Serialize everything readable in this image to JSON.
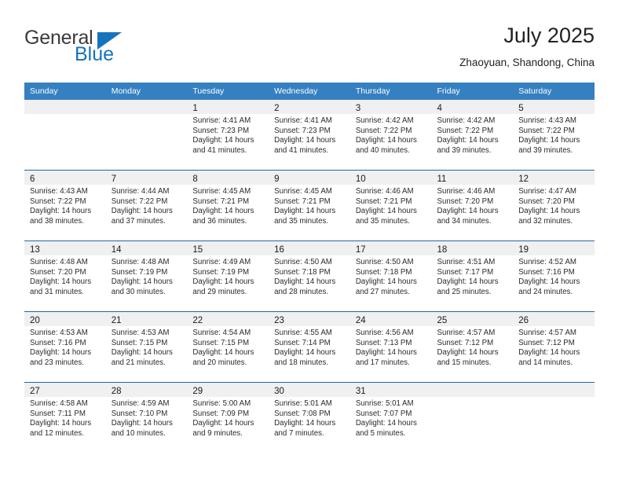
{
  "brand": {
    "name_top": "General",
    "name_bottom": "Blue",
    "triangle_color": "#1673bd"
  },
  "header": {
    "title": "July 2025",
    "location": "Zhaoyuan, Shandong, China"
  },
  "theme": {
    "header_blue": "#3580c0",
    "row_divider_blue": "#2266a8",
    "daynum_band": "#f0f0f0",
    "text": "#2b2b2b"
  },
  "calendar": {
    "weekday_headers": [
      "Sunday",
      "Monday",
      "Tuesday",
      "Wednesday",
      "Thursday",
      "Friday",
      "Saturday"
    ],
    "labels": {
      "sunrise": "Sunrise:",
      "sunset": "Sunset:",
      "daylight": "Daylight:"
    },
    "weeks": [
      [
        {
          "day": "",
          "lines": []
        },
        {
          "day": "",
          "lines": []
        },
        {
          "day": "1",
          "lines": [
            "Sunrise: 4:41 AM",
            "Sunset: 7:23 PM",
            "Daylight: 14 hours and 41 minutes."
          ]
        },
        {
          "day": "2",
          "lines": [
            "Sunrise: 4:41 AM",
            "Sunset: 7:23 PM",
            "Daylight: 14 hours and 41 minutes."
          ]
        },
        {
          "day": "3",
          "lines": [
            "Sunrise: 4:42 AM",
            "Sunset: 7:22 PM",
            "Daylight: 14 hours and 40 minutes."
          ]
        },
        {
          "day": "4",
          "lines": [
            "Sunrise: 4:42 AM",
            "Sunset: 7:22 PM",
            "Daylight: 14 hours and 39 minutes."
          ]
        },
        {
          "day": "5",
          "lines": [
            "Sunrise: 4:43 AM",
            "Sunset: 7:22 PM",
            "Daylight: 14 hours and 39 minutes."
          ]
        }
      ],
      [
        {
          "day": "6",
          "lines": [
            "Sunrise: 4:43 AM",
            "Sunset: 7:22 PM",
            "Daylight: 14 hours and 38 minutes."
          ]
        },
        {
          "day": "7",
          "lines": [
            "Sunrise: 4:44 AM",
            "Sunset: 7:22 PM",
            "Daylight: 14 hours and 37 minutes."
          ]
        },
        {
          "day": "8",
          "lines": [
            "Sunrise: 4:45 AM",
            "Sunset: 7:21 PM",
            "Daylight: 14 hours and 36 minutes."
          ]
        },
        {
          "day": "9",
          "lines": [
            "Sunrise: 4:45 AM",
            "Sunset: 7:21 PM",
            "Daylight: 14 hours and 35 minutes."
          ]
        },
        {
          "day": "10",
          "lines": [
            "Sunrise: 4:46 AM",
            "Sunset: 7:21 PM",
            "Daylight: 14 hours and 35 minutes."
          ]
        },
        {
          "day": "11",
          "lines": [
            "Sunrise: 4:46 AM",
            "Sunset: 7:20 PM",
            "Daylight: 14 hours and 34 minutes."
          ]
        },
        {
          "day": "12",
          "lines": [
            "Sunrise: 4:47 AM",
            "Sunset: 7:20 PM",
            "Daylight: 14 hours and 32 minutes."
          ]
        }
      ],
      [
        {
          "day": "13",
          "lines": [
            "Sunrise: 4:48 AM",
            "Sunset: 7:20 PM",
            "Daylight: 14 hours and 31 minutes."
          ]
        },
        {
          "day": "14",
          "lines": [
            "Sunrise: 4:48 AM",
            "Sunset: 7:19 PM",
            "Daylight: 14 hours and 30 minutes."
          ]
        },
        {
          "day": "15",
          "lines": [
            "Sunrise: 4:49 AM",
            "Sunset: 7:19 PM",
            "Daylight: 14 hours and 29 minutes."
          ]
        },
        {
          "day": "16",
          "lines": [
            "Sunrise: 4:50 AM",
            "Sunset: 7:18 PM",
            "Daylight: 14 hours and 28 minutes."
          ]
        },
        {
          "day": "17",
          "lines": [
            "Sunrise: 4:50 AM",
            "Sunset: 7:18 PM",
            "Daylight: 14 hours and 27 minutes."
          ]
        },
        {
          "day": "18",
          "lines": [
            "Sunrise: 4:51 AM",
            "Sunset: 7:17 PM",
            "Daylight: 14 hours and 25 minutes."
          ]
        },
        {
          "day": "19",
          "lines": [
            "Sunrise: 4:52 AM",
            "Sunset: 7:16 PM",
            "Daylight: 14 hours and 24 minutes."
          ]
        }
      ],
      [
        {
          "day": "20",
          "lines": [
            "Sunrise: 4:53 AM",
            "Sunset: 7:16 PM",
            "Daylight: 14 hours and 23 minutes."
          ]
        },
        {
          "day": "21",
          "lines": [
            "Sunrise: 4:53 AM",
            "Sunset: 7:15 PM",
            "Daylight: 14 hours and 21 minutes."
          ]
        },
        {
          "day": "22",
          "lines": [
            "Sunrise: 4:54 AM",
            "Sunset: 7:15 PM",
            "Daylight: 14 hours and 20 minutes."
          ]
        },
        {
          "day": "23",
          "lines": [
            "Sunrise: 4:55 AM",
            "Sunset: 7:14 PM",
            "Daylight: 14 hours and 18 minutes."
          ]
        },
        {
          "day": "24",
          "lines": [
            "Sunrise: 4:56 AM",
            "Sunset: 7:13 PM",
            "Daylight: 14 hours and 17 minutes."
          ]
        },
        {
          "day": "25",
          "lines": [
            "Sunrise: 4:57 AM",
            "Sunset: 7:12 PM",
            "Daylight: 14 hours and 15 minutes."
          ]
        },
        {
          "day": "26",
          "lines": [
            "Sunrise: 4:57 AM",
            "Sunset: 7:12 PM",
            "Daylight: 14 hours and 14 minutes."
          ]
        }
      ],
      [
        {
          "day": "27",
          "lines": [
            "Sunrise: 4:58 AM",
            "Sunset: 7:11 PM",
            "Daylight: 14 hours and 12 minutes."
          ]
        },
        {
          "day": "28",
          "lines": [
            "Sunrise: 4:59 AM",
            "Sunset: 7:10 PM",
            "Daylight: 14 hours and 10 minutes."
          ]
        },
        {
          "day": "29",
          "lines": [
            "Sunrise: 5:00 AM",
            "Sunset: 7:09 PM",
            "Daylight: 14 hours and 9 minutes."
          ]
        },
        {
          "day": "30",
          "lines": [
            "Sunrise: 5:01 AM",
            "Sunset: 7:08 PM",
            "Daylight: 14 hours and 7 minutes."
          ]
        },
        {
          "day": "31",
          "lines": [
            "Sunrise: 5:01 AM",
            "Sunset: 7:07 PM",
            "Daylight: 14 hours and 5 minutes."
          ]
        },
        {
          "day": "",
          "lines": []
        },
        {
          "day": "",
          "lines": []
        }
      ]
    ]
  }
}
